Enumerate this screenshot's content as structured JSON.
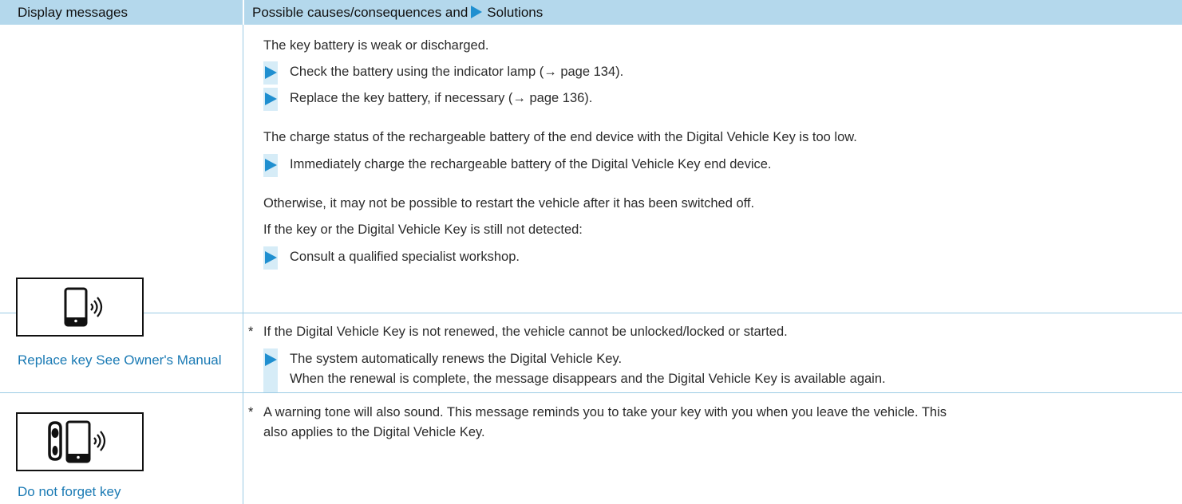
{
  "header": {
    "col1": "Display messages",
    "col2_prefix": "Possible causes/consequences and",
    "col2_suffix": "Solutions"
  },
  "row1": {
    "p1": "The key battery is weak or discharged.",
    "a1": "Check the battery using the indicator lamp (→ page 134).",
    "a2": "Replace the key battery, if necessary (→ page 136).",
    "p2": "The charge status of the rechargeable battery of the end device with the Digital Vehicle Key is too low.",
    "a3": "Immediately charge the rechargeable battery of the Digital Vehicle Key end device.",
    "p3": "Otherwise, it may not be possible to restart the vehicle after it has been switched off.",
    "p4": "If the key or the Digital Vehicle Key is still not detected:",
    "a4": "Consult a qualified specialist workshop."
  },
  "row2": {
    "icon": "phone-wireless-icon",
    "label": "Replace key See Owner's Manual",
    "asterisk": "*",
    "p1": "If the Digital Vehicle Key is not renewed, the vehicle cannot be unlocked/locked or started.",
    "a1_line1": "The system automatically renews the Digital Vehicle Key.",
    "a1_line2": "When the renewal is complete, the message disappears and the Digital Vehicle Key is available again."
  },
  "row3": {
    "icon": "key-phone-wireless-icon",
    "label": "Do not forget key",
    "asterisk": "*",
    "p1_line1": "A warning tone will also sound. This message reminds you to take your key with you when you leave the vehicle. This",
    "p1_line2": "also applies to the Digital Vehicle Key."
  },
  "colors": {
    "header_bg": "#b4d8ec",
    "arrow": "#1f8fd0",
    "arrow_bg": "#d6ecf7",
    "label_text": "#1a7ab4",
    "rule": "#9bcbe4"
  }
}
